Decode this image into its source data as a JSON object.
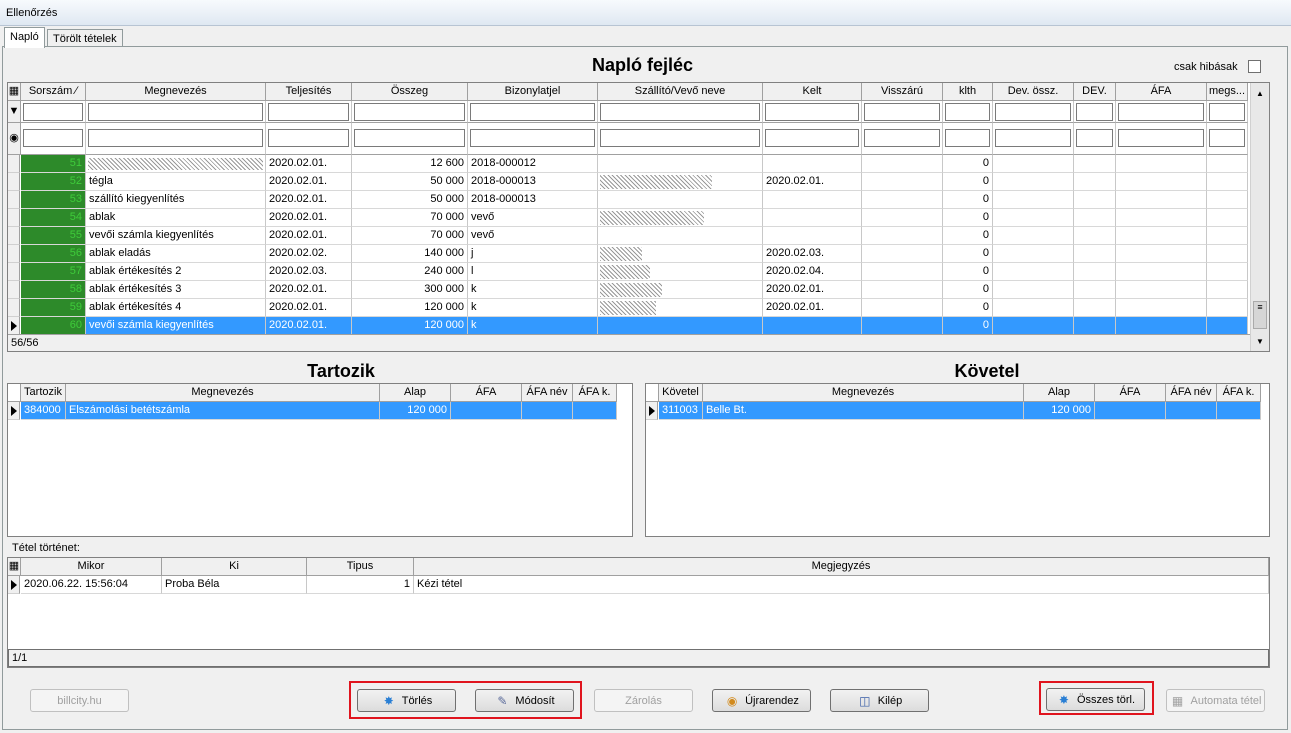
{
  "window": {
    "title": "Ellenőrzés"
  },
  "tabs": [
    {
      "label": "Napló"
    },
    {
      "label": "Törölt tételek"
    }
  ],
  "journal": {
    "title": "Napló fejléc",
    "errors_only_label": "csak hibásak",
    "columns": [
      "Sorszám",
      "Megnevezés",
      "Teljesítés",
      "Összeg",
      "Bizonylatjel",
      "Szállító/Vevő neve",
      "Kelt",
      "Visszárú",
      "klth",
      "Dev. össz.",
      "DEV.",
      "ÁFA",
      "megs..."
    ],
    "rows": [
      {
        "no": "51",
        "name": "",
        "date": "2020.02.01.",
        "amount": "12 600",
        "doc": "2018-000012",
        "partner": "",
        "kelt": "",
        "visszaru": "",
        "klth": "0"
      },
      {
        "no": "52",
        "name": "tégla",
        "date": "2020.02.01.",
        "amount": "50 000",
        "doc": "2018-000013",
        "partner": "",
        "kelt": "2020.02.01.",
        "visszaru": "",
        "klth": "0"
      },
      {
        "no": "53",
        "name": "szállító kiegyenlítés",
        "date": "2020.02.01.",
        "amount": "50 000",
        "doc": "2018-000013",
        "partner": "",
        "kelt": "",
        "visszaru": "",
        "klth": "0"
      },
      {
        "no": "54",
        "name": "ablak",
        "date": "2020.02.01.",
        "amount": "70 000",
        "doc": "vevő",
        "partner": "",
        "kelt": "",
        "visszaru": "",
        "klth": "0"
      },
      {
        "no": "55",
        "name": "vevői számla kiegyenlítés",
        "date": "2020.02.01.",
        "amount": "70 000",
        "doc": "vevő",
        "partner": "",
        "kelt": "",
        "visszaru": "",
        "klth": "0"
      },
      {
        "no": "56",
        "name": "ablak eladás",
        "date": "2020.02.02.",
        "amount": "140 000",
        "doc": "j",
        "partner": "",
        "kelt": "2020.02.03.",
        "visszaru": "",
        "klth": "0"
      },
      {
        "no": "57",
        "name": "ablak értékesítés 2",
        "date": "2020.02.03.",
        "amount": "240 000",
        "doc": "l",
        "partner": "",
        "kelt": "2020.02.04.",
        "visszaru": "",
        "klth": "0"
      },
      {
        "no": "58",
        "name": "ablak értékesítés 3",
        "date": "2020.02.01.",
        "amount": "300 000",
        "doc": "k",
        "partner": "",
        "kelt": "2020.02.01.",
        "visszaru": "",
        "klth": "0"
      },
      {
        "no": "59",
        "name": "ablak értékesítés 4",
        "date": "2020.02.01.",
        "amount": "120 000",
        "doc": "k",
        "partner": "",
        "kelt": "2020.02.01.",
        "visszaru": "",
        "klth": "0"
      },
      {
        "no": "60",
        "name": "vevői számla kiegyenlítés",
        "date": "2020.02.01.",
        "amount": "120 000",
        "doc": "k",
        "partner": "",
        "kelt": "",
        "visszaru": "",
        "klth": "0"
      }
    ],
    "count": "56/56"
  },
  "debit": {
    "title": "Tartozik",
    "columns": [
      "Tartozik",
      "Megnevezés",
      "Alap",
      "ÁFA",
      "ÁFA név",
      "ÁFA k."
    ],
    "row": {
      "account": "384000",
      "name": "Elszámolási betétszámla",
      "alap": "120 000"
    }
  },
  "credit": {
    "title": "Követel",
    "columns": [
      "Követel",
      "Megnevezés",
      "Alap",
      "ÁFA",
      "ÁFA név",
      "ÁFA k."
    ],
    "row": {
      "account": "311003",
      "name": "Belle Bt.",
      "alap": "120 000"
    }
  },
  "history": {
    "label": "Tétel történet:",
    "columns": [
      "Mikor",
      "Ki",
      "Tipus",
      "Megjegyzés"
    ],
    "row": {
      "mikor": "2020.06.22. 15:56:04",
      "ki": "Proba Béla",
      "tipus": "1",
      "megjegyzes": "Kézi tétel"
    },
    "count": "1/1"
  },
  "buttons": {
    "billcity": "billcity.hu",
    "torles": "Törlés",
    "modosit": "Módosít",
    "zarolas": "Zárolás",
    "ujrarendez": "Újrarendez",
    "kilep": "Kilép",
    "osszes_torl": "Összes törl.",
    "automata": "Automata tétel"
  },
  "colors": {
    "selection": "#3399ff",
    "sorszam_bg": "#2d8a2a",
    "highlight_box": "#e0141e"
  }
}
